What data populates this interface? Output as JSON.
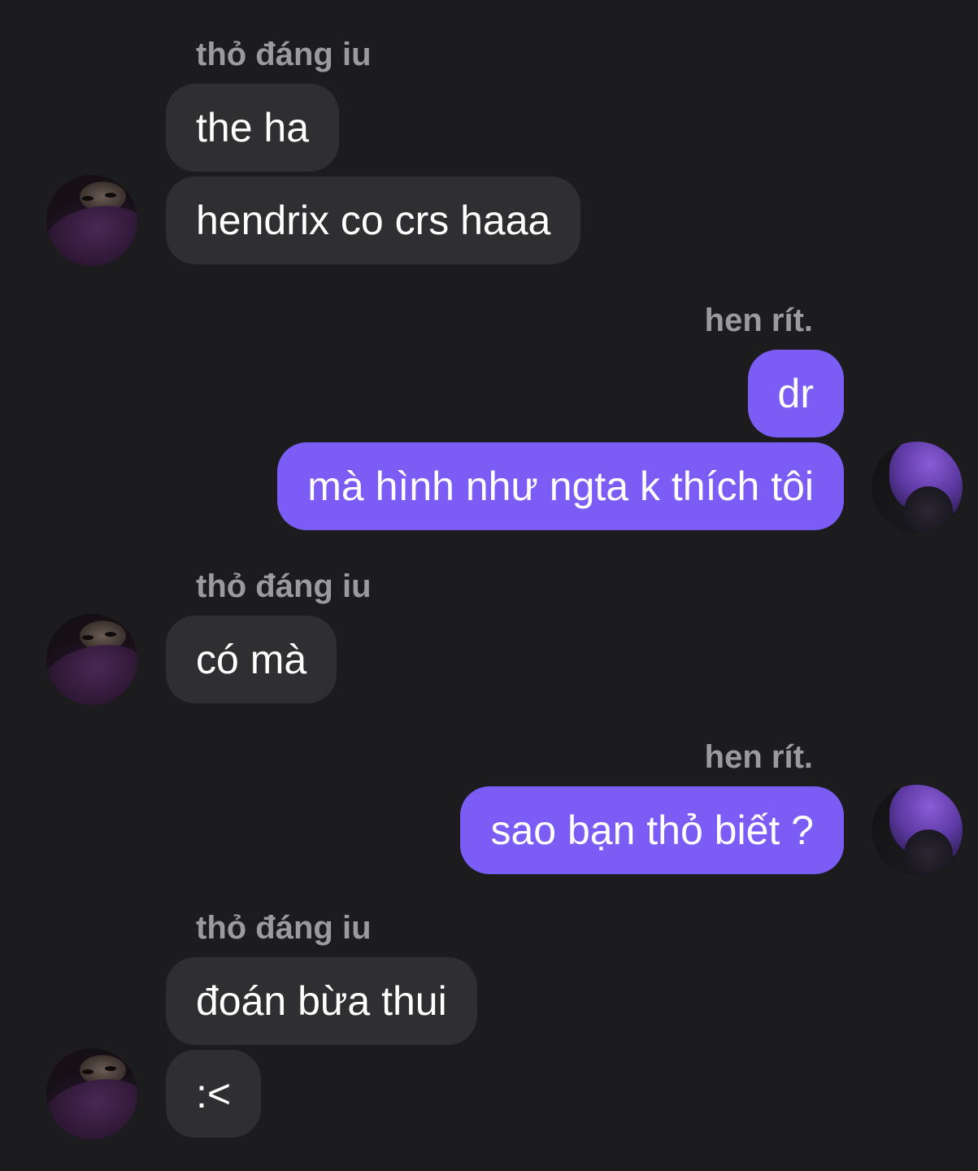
{
  "conversation": {
    "groups": [
      {
        "sender": "thỏ đáng iu",
        "direction": "in",
        "messages": [
          "the ha",
          "hendrix co crs haaa"
        ]
      },
      {
        "sender": "hen rít.",
        "direction": "out",
        "messages": [
          "dr",
          "mà hình như ngta k thích tôi"
        ]
      },
      {
        "sender": "thỏ đáng iu",
        "direction": "in",
        "messages": [
          "có mà"
        ]
      },
      {
        "sender": "hen rít.",
        "direction": "out",
        "messages": [
          "sao bạn thỏ biết ?"
        ]
      },
      {
        "sender": "thỏ đáng iu",
        "direction": "in",
        "messages": [
          "đoán bừa thui",
          ":<"
        ]
      }
    ]
  },
  "theme": {
    "background": "#1c1c1e",
    "incoming_bubble": "#2f2f31",
    "outgoing_bubble": "#7b5cf5",
    "sender_name": "#9a9a9f"
  }
}
